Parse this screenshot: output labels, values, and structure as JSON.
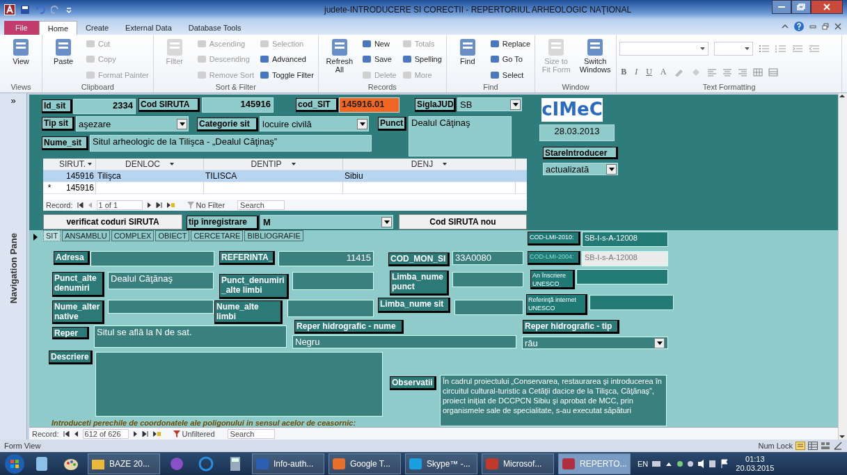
{
  "window": {
    "title": "judete-INTRODUCERE SI CORECTII - REPERTORIUL ARHEOLOGIC NAŢIONAL"
  },
  "ribbon_tabs": [
    {
      "label": "File",
      "selected": false,
      "kind": "file"
    },
    {
      "label": "Home",
      "selected": true,
      "kind": "tab"
    },
    {
      "label": "Create",
      "selected": false,
      "kind": "tab"
    },
    {
      "label": "External Data",
      "selected": false,
      "kind": "tab"
    },
    {
      "label": "Database Tools",
      "selected": false,
      "kind": "tab"
    }
  ],
  "ribbon_groups": [
    {
      "label": "Views",
      "commands": [
        {
          "label": "View",
          "kind": "large",
          "disabled": false
        }
      ]
    },
    {
      "label": "Clipboard",
      "commands": [
        {
          "label": "Paste",
          "kind": "large",
          "disabled": false
        },
        {
          "label": "Cut",
          "kind": "small",
          "disabled": true
        },
        {
          "label": "Copy",
          "kind": "small",
          "disabled": true
        },
        {
          "label": "Format Painter",
          "kind": "small",
          "disabled": true
        }
      ]
    },
    {
      "label": "Sort & Filter",
      "commands": [
        {
          "label": "Filter",
          "kind": "large",
          "disabled": true
        },
        {
          "label": "Ascending",
          "kind": "small",
          "disabled": true
        },
        {
          "label": "Descending",
          "kind": "small",
          "disabled": true
        },
        {
          "label": "Remove Sort",
          "kind": "small",
          "disabled": true
        },
        {
          "label": "Selection",
          "kind": "small",
          "disabled": true
        },
        {
          "label": "Advanced",
          "kind": "small",
          "disabled": false
        },
        {
          "label": "Toggle Filter",
          "kind": "small",
          "disabled": false
        }
      ]
    },
    {
      "label": "Records",
      "commands": [
        {
          "label": "Refresh All",
          "kind": "large",
          "disabled": false
        },
        {
          "label": "New",
          "kind": "small",
          "disabled": false
        },
        {
          "label": "Save",
          "kind": "small",
          "disabled": false
        },
        {
          "label": "Delete",
          "kind": "small",
          "disabled": true
        },
        {
          "label": "Totals",
          "kind": "small",
          "disabled": true
        },
        {
          "label": "Spelling",
          "kind": "small",
          "disabled": false
        },
        {
          "label": "More",
          "kind": "small",
          "disabled": true
        }
      ]
    },
    {
      "label": "Find",
      "commands": [
        {
          "label": "Find",
          "kind": "large",
          "disabled": false
        },
        {
          "label": "Replace",
          "kind": "small",
          "disabled": false
        },
        {
          "label": "Go To",
          "kind": "small",
          "disabled": false
        },
        {
          "label": "Select",
          "kind": "small",
          "disabled": false
        }
      ]
    },
    {
      "label": "Window",
      "commands": [
        {
          "label": "Size to Fit Form",
          "kind": "large",
          "disabled": true
        },
        {
          "label": "Switch Windows",
          "kind": "large",
          "disabled": false
        }
      ]
    }
  ],
  "text_formatting": {
    "label": "Text Formatting",
    "buttons": [
      "B",
      "I",
      "U",
      "A"
    ]
  },
  "navigation_pane": {
    "label": "Navigation Pane",
    "toggle": "»"
  },
  "logo": "cIMeC",
  "header_fields": [
    {
      "label": "Id_sit",
      "value": "2334",
      "kind": "number"
    },
    {
      "label": "Cod SIRUTA",
      "value": "145916",
      "kind": "number"
    },
    {
      "label": "cod_SIT",
      "value": "145916.01",
      "kind": "alert"
    },
    {
      "label": "SiglaJUD",
      "value": "SB",
      "kind": "combo"
    },
    {
      "label": "Tip sit",
      "value": "aşezare",
      "kind": "combo"
    },
    {
      "label": "Categorie sit",
      "value": "locuire civilă",
      "kind": "combo"
    },
    {
      "label": "Punct",
      "value": "Dealul Căţinaş",
      "kind": "memo"
    },
    {
      "label": "Nume_sit",
      "value": "Situl arheologic de la Tilişca - „Dealul Căţinaş”",
      "kind": "text"
    },
    {
      "value": "28.03.2013",
      "kind": "date"
    },
    {
      "label": "StareIntroducer",
      "value": "actualizată",
      "kind": "combo"
    }
  ],
  "subform": {
    "columns": [
      "SIRUT.",
      "DENLOC",
      "DENTIP",
      "DENJ"
    ],
    "rows": [
      {
        "cells": [
          "145916",
          "Tilişca",
          "TILISCA",
          "Sibiu"
        ],
        "selected": true
      }
    ],
    "new_row": {
      "marker": "*",
      "cells": [
        "145916",
        "",
        "",
        ""
      ]
    },
    "nav": {
      "label": "Record:",
      "position": "1 of 1",
      "filter": "No Filter",
      "search": "Search"
    }
  },
  "actions": {
    "verify_button": "verificat coduri SIRUTA",
    "type_label": "tip înregistrare",
    "type_value": "M",
    "new_button": "Cod SIRUTA nou"
  },
  "form_tabs": [
    {
      "label": "SIT",
      "selected": true
    },
    {
      "label": "ANSAMBLU",
      "selected": false
    },
    {
      "label": "COMPLEX",
      "selected": false
    },
    {
      "label": "OBIECT",
      "selected": false
    },
    {
      "label": "CERCETARE",
      "selected": false
    },
    {
      "label": "BIBLIOGRAFIE",
      "selected": false
    }
  ],
  "detail_fields": [
    {
      "label": "COD-LMI-2010:",
      "value": "SB-I-s-A-12008",
      "kind": "small",
      "disabled": false
    },
    {
      "label": "Adresa",
      "kind": "text",
      "disabled": false
    },
    {
      "label": "REFERINTA_",
      "value": "11415",
      "kind": "number",
      "disabled": false
    },
    {
      "label": "COD_MON_SI",
      "value": "33A0080",
      "kind": "text",
      "disabled": false
    },
    {
      "label": "COD-LMI-2004:",
      "value": "SB-I-s-A-12008",
      "kind": "small",
      "disabled": true
    },
    {
      "label": "Punct_alte denumiri",
      "value": "Dealul Căţănaş",
      "kind": "text",
      "disabled": false
    },
    {
      "label": "Punct_denumiri _alte limbi",
      "kind": "text",
      "disabled": false
    },
    {
      "label": "Limba_nume punct",
      "kind": "text",
      "disabled": false
    },
    {
      "label": "An înscriere UNESCO",
      "kind": "small",
      "disabled": false
    },
    {
      "label": "Nume_alter native",
      "kind": "text",
      "disabled": false
    },
    {
      "label": "Nume_alte limbi",
      "kind": "text",
      "disabled": false
    },
    {
      "label": "Limba_nume sit",
      "kind": "text",
      "disabled": false
    },
    {
      "label": "Referinţă internet UNESCO",
      "kind": "small",
      "disabled": false
    },
    {
      "label": "Reper",
      "value": "Situl se află la N de sat.",
      "kind": "text",
      "disabled": false
    },
    {
      "label": "Reper hidrografic - nume",
      "value": "Negru",
      "kind": "text",
      "disabled": false
    },
    {
      "label": "Reper hidrografic - tip",
      "value": "râu",
      "kind": "combo",
      "disabled": false
    },
    {
      "label": "Descriere",
      "kind": "memo",
      "disabled": false
    },
    {
      "label": "Observatii",
      "value": "În cadrul proiectului „Conservarea, restaurarea şi introducerea în circuitul cultural-turistic a Cetăţii dacice de la Tilişca, Căţănaş”, proiect iniţiat de DCCPCN Sibiu şi aprobat de MCC, prin organismele sale de specialitate, s-au executat săpături",
      "kind": "memo",
      "disabled": false
    }
  ],
  "instruction": "Introduceti perechile de coordonatele ale poligonului in sensul acelor de ceasornic:",
  "record_nav": {
    "label": "Record:",
    "position": "612 of 626",
    "filter": "Unfiltered",
    "search": "Search"
  },
  "status_bar": {
    "view": "Form View",
    "num_lock": "Num Lock"
  },
  "taskbar": {
    "tasks": [
      {
        "label": "BAZE 20...",
        "selected": false
      },
      {
        "label": "Info-auth...",
        "selected": false
      },
      {
        "label": "Google T...",
        "selected": false
      },
      {
        "label": "Skype™ -...",
        "selected": false
      },
      {
        "label": "Microsof...",
        "selected": false
      },
      {
        "label": "REPERTO...",
        "selected": true
      }
    ],
    "language": "EN",
    "time": "01:13",
    "date": "20.03.2015"
  }
}
